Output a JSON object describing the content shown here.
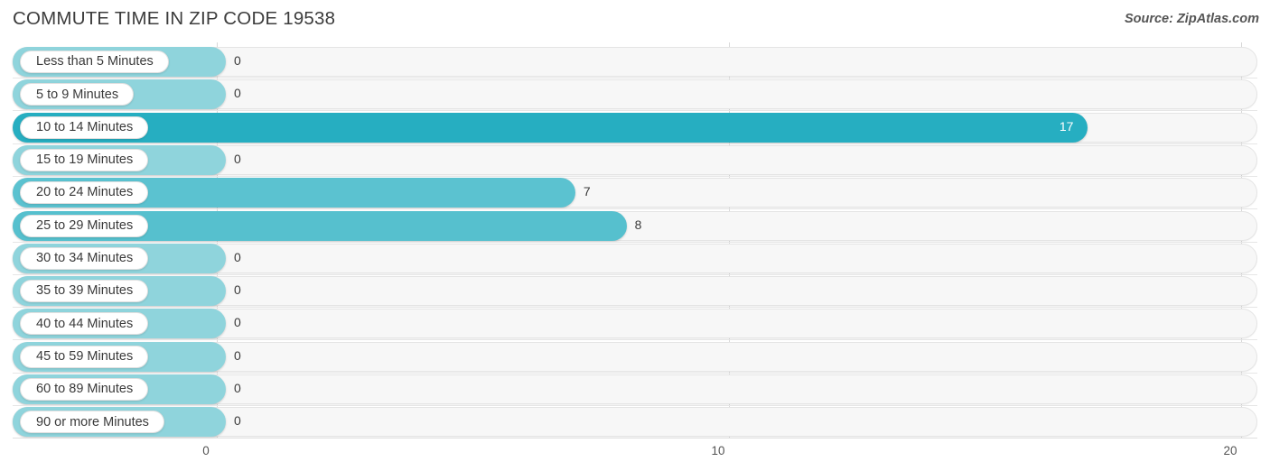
{
  "header": {
    "title": "COMMUTE TIME IN ZIP CODE 19538",
    "source": "Source: ZipAtlas.com"
  },
  "axis": {
    "ticks": [
      "0",
      "10",
      "20"
    ]
  },
  "chart_data": {
    "type": "bar",
    "orientation": "horizontal",
    "title": "COMMUTE TIME IN ZIP CODE 19538",
    "subtitle": "Source: ZipAtlas.com",
    "xlabel": "",
    "ylabel": "",
    "xlim": [
      0,
      20
    ],
    "xticks": [
      0,
      10,
      20
    ],
    "grid": true,
    "legend": false,
    "categories": [
      "Less than 5 Minutes",
      "5 to 9 Minutes",
      "10 to 14 Minutes",
      "15 to 19 Minutes",
      "20 to 24 Minutes",
      "25 to 29 Minutes",
      "30 to 34 Minutes",
      "35 to 39 Minutes",
      "40 to 44 Minutes",
      "45 to 59 Minutes",
      "60 to 89 Minutes",
      "90 or more Minutes"
    ],
    "values": [
      0,
      0,
      17,
      0,
      7,
      8,
      0,
      0,
      0,
      0,
      0,
      0
    ],
    "value_labels": [
      "0",
      "0",
      "17",
      "0",
      "7",
      "8",
      "0",
      "0",
      "0",
      "0",
      "0",
      "0"
    ],
    "bar_colors": [
      "#8FD4DC",
      "#8FD4DC",
      "#26AEC1",
      "#8FD4DC",
      "#5BC2D0",
      "#56C0CE",
      "#8FD4DC",
      "#8FD4DC",
      "#8FD4DC",
      "#8FD4DC",
      "#8FD4DC",
      "#8FD4DC"
    ],
    "track_color": "#F7F7F7",
    "gridline_color": "#D8D8D8"
  }
}
